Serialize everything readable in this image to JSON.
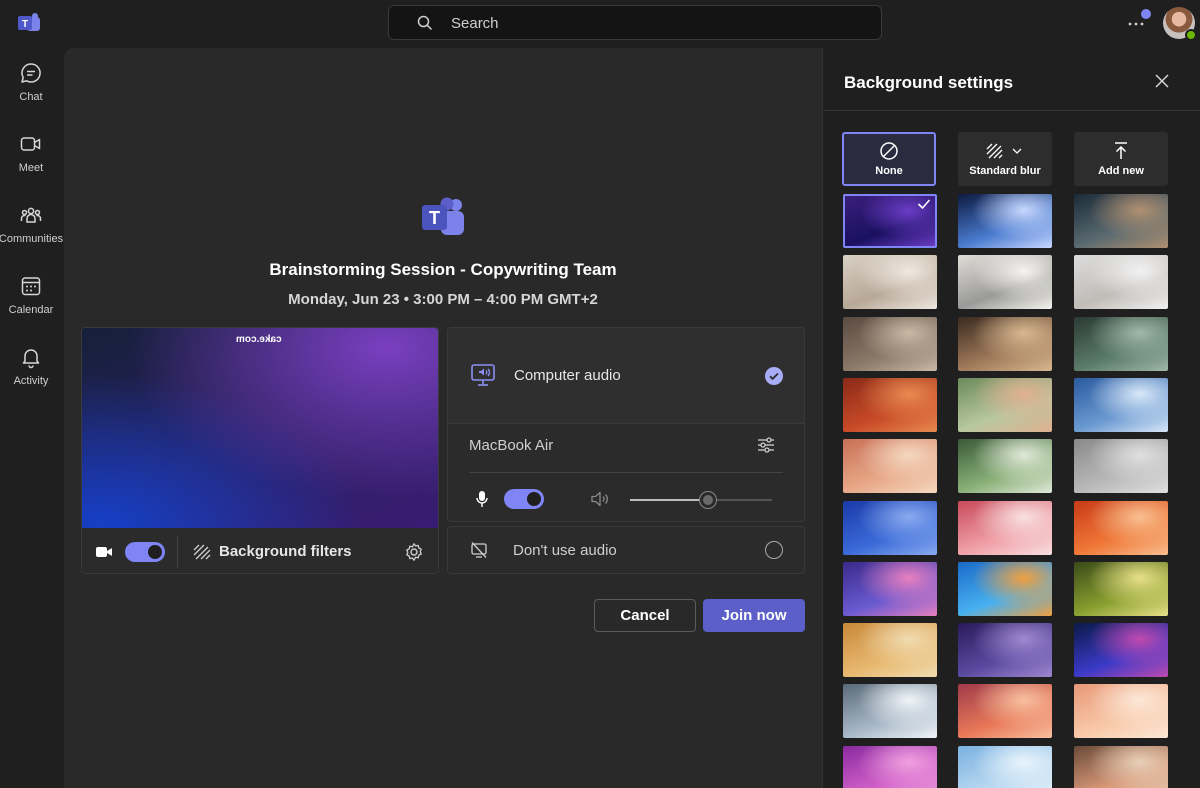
{
  "search": {
    "placeholder": "Search"
  },
  "rail": {
    "items": [
      {
        "label": "Chat",
        "icon": "chat-icon"
      },
      {
        "label": "Meet",
        "icon": "video-icon"
      },
      {
        "label": "Communities",
        "icon": "communities-icon"
      },
      {
        "label": "Calendar",
        "icon": "calendar-icon"
      },
      {
        "label": "Activity",
        "icon": "bell-icon"
      }
    ]
  },
  "meeting": {
    "title": "Brainstorming Session - Copywriting Team",
    "time": "Monday, Jun 23  •  3:00 PM  –  4:00 PM  GMT+2"
  },
  "preview": {
    "wall_text": "cake.com",
    "camera_on": true,
    "background_filters_label": "Background filters"
  },
  "audio": {
    "computer_audio_label": "Computer audio",
    "computer_audio_selected": true,
    "device_name": "MacBook Air",
    "mic_on": true,
    "volume_fraction": 0.55,
    "dont_use_audio_label": "Don't use audio"
  },
  "actions": {
    "cancel_label": "Cancel",
    "join_label": "Join now"
  },
  "background_panel": {
    "title": "Background settings",
    "options": [
      {
        "label": "None",
        "icon": "none-icon",
        "selected": true
      },
      {
        "label": "Standard blur",
        "icon": "blur-icon",
        "selected": false
      },
      {
        "label": "Add new",
        "icon": "upload-icon",
        "selected": false
      }
    ],
    "thumbnails": [
      {
        "name": "purple-gradient",
        "colors": [
          "#3a1f7a",
          "#1a1060",
          "#6a3cc4"
        ],
        "selected": true
      },
      {
        "name": "space-warp",
        "colors": [
          "#0d1a40",
          "#4a7bd0",
          "#c8d8ff"
        ],
        "selected": false
      },
      {
        "name": "desert-planet",
        "colors": [
          "#1a2a38",
          "#5a6a70",
          "#b09070"
        ],
        "selected": false
      },
      {
        "name": "minimal-room",
        "colors": [
          "#d8d0c4",
          "#b8a898",
          "#efe9e1"
        ],
        "selected": false
      },
      {
        "name": "white-loft",
        "colors": [
          "#e0ddd8",
          "#9a9a98",
          "#f6f4f0"
        ],
        "selected": false
      },
      {
        "name": "white-arch-room",
        "colors": [
          "#dcdcdc",
          "#c0bcb8",
          "#f2f2f2"
        ],
        "selected": false
      },
      {
        "name": "concrete-lounge",
        "colors": [
          "#5a4a40",
          "#8a7868",
          "#c8b8a4"
        ],
        "selected": false
      },
      {
        "name": "warm-dining",
        "colors": [
          "#3a2a20",
          "#a07a5a",
          "#d8b890"
        ],
        "selected": false
      },
      {
        "name": "glass-atrium",
        "colors": [
          "#2a3a34",
          "#5a7a68",
          "#a0b8a8"
        ],
        "selected": false
      },
      {
        "name": "red-patio",
        "colors": [
          "#8a2a18",
          "#c84a28",
          "#e88a50"
        ],
        "selected": false
      },
      {
        "name": "green-arches",
        "colors": [
          "#6a8a5a",
          "#b8c8a0",
          "#e0b090"
        ],
        "selected": false
      },
      {
        "name": "blue-balcony",
        "colors": [
          "#2a5aa0",
          "#6a98d0",
          "#d8e8f8"
        ],
        "selected": false
      },
      {
        "name": "terracotta-arch",
        "colors": [
          "#c87058",
          "#e8a888",
          "#f4d8c0"
        ],
        "selected": false
      },
      {
        "name": "garden-portal",
        "colors": [
          "#3a5a38",
          "#8ab078",
          "#e0e8d8"
        ],
        "selected": false
      },
      {
        "name": "grey-doorway",
        "colors": [
          "#8a8a8a",
          "#b8b8b8",
          "#e0e0e0"
        ],
        "selected": false
      },
      {
        "name": "blue-window",
        "colors": [
          "#1a3aa8",
          "#3a6ad8",
          "#8aaaf0"
        ],
        "selected": false
      },
      {
        "name": "pink-forest",
        "colors": [
          "#c84a5a",
          "#f0a0a8",
          "#f8e0e0"
        ],
        "selected": false
      },
      {
        "name": "autumn-trees",
        "colors": [
          "#c83a18",
          "#f07838",
          "#f8c090"
        ],
        "selected": false
      },
      {
        "name": "coral-reef",
        "colors": [
          "#3a2a8a",
          "#6a5ad0",
          "#e880c0"
        ],
        "selected": false
      },
      {
        "name": "underwater",
        "colors": [
          "#1a6ac8",
          "#48b0f0",
          "#f0a040"
        ],
        "selected": false
      },
      {
        "name": "jungle-light",
        "colors": [
          "#3a4a18",
          "#8aa030",
          "#e8e088"
        ],
        "selected": false
      },
      {
        "name": "golden-hills",
        "colors": [
          "#c8883a",
          "#e8b870",
          "#f0dcb0"
        ],
        "selected": false
      },
      {
        "name": "purple-mountains",
        "colors": [
          "#2a1a5a",
          "#5a4aa0",
          "#a088d0"
        ],
        "selected": false
      },
      {
        "name": "aurora-night",
        "colors": [
          "#0a1a48",
          "#3a3ac8",
          "#c04ab0"
        ],
        "selected": false
      },
      {
        "name": "snowy-peaks",
        "colors": [
          "#5a6a78",
          "#a8b8c8",
          "#f0f4f8"
        ],
        "selected": false
      },
      {
        "name": "sunset-clouds",
        "colors": [
          "#a03a4a",
          "#e87858",
          "#f8c0a0"
        ],
        "selected": false
      },
      {
        "name": "peach-petals",
        "colors": [
          "#e89878",
          "#f8c8a8",
          "#fce8d8"
        ],
        "selected": false
      },
      {
        "name": "magenta-flowers",
        "colors": [
          "#8a2aa0",
          "#d060c8",
          "#f0a0e0"
        ],
        "selected": false
      },
      {
        "name": "blue-fish",
        "colors": [
          "#7ab0e0",
          "#b8d8f0",
          "#e8f4fc"
        ],
        "selected": false
      },
      {
        "name": "flower-garden",
        "colors": [
          "#6a4a38",
          "#d89878",
          "#e8d0b8"
        ],
        "selected": false
      }
    ]
  }
}
